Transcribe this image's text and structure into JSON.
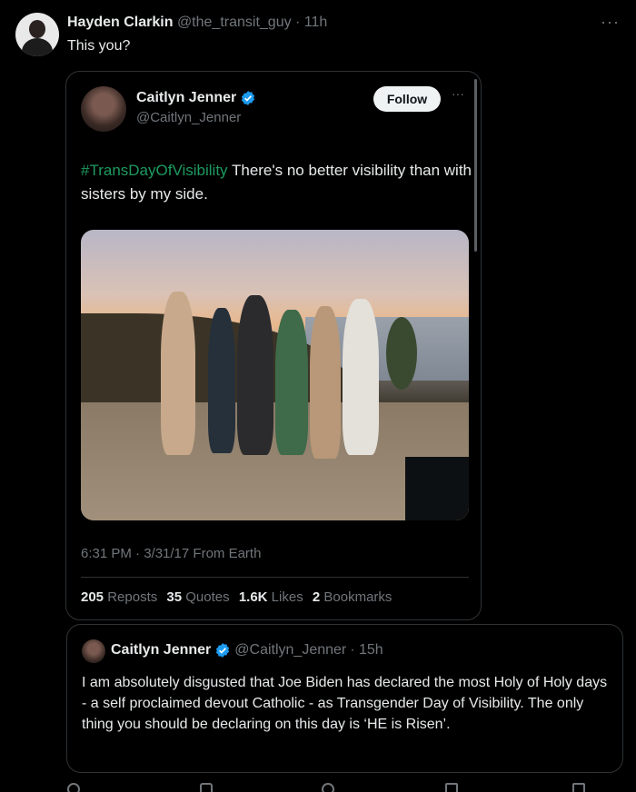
{
  "outer_tweet": {
    "author_name": "Hayden Clarkin",
    "handle": "@the_transit_guy",
    "time": "· 11h",
    "more": "···",
    "text": "This you?"
  },
  "embedded_tweet": {
    "author_name": "Caitlyn Jenner",
    "handle": "@Caitlyn_Jenner",
    "follow_label": "Follow",
    "more": "···",
    "hashtag": "#TransDayOfVisibility",
    "text": " There's no better visibility than with sisters by my side.",
    "meta": "6:31 PM · 3/31/17 From Earth",
    "stats": {
      "reposts_value": "205",
      "reposts_label": "Reposts",
      "quotes_value": "35",
      "quotes_label": "Quotes",
      "likes_value": "1.6K",
      "likes_label": "Likes",
      "bookmarks_value": "2",
      "bookmarks_label": "Bookmarks"
    }
  },
  "quoted_tweet": {
    "author_name": "Caitlyn Jenner",
    "handle": "@Caitlyn_Jenner",
    "time": "· 15h",
    "text": "I am absolutely disgusted that Joe Biden has declared the most Holy of Holy days - a self proclaimed devout Catholic - as Transgender Day of Visibility. The only thing you should be declaring on this day is ‘HE is Risen’."
  },
  "colors": {
    "background": "#000000",
    "text": "#e7e9ea",
    "muted": "#71767b",
    "hashtag": "#1d9b5f",
    "verified": "#1d9bf0",
    "border": "#2f3336"
  },
  "icons": [
    "verified-badge-icon",
    "more-icon"
  ]
}
